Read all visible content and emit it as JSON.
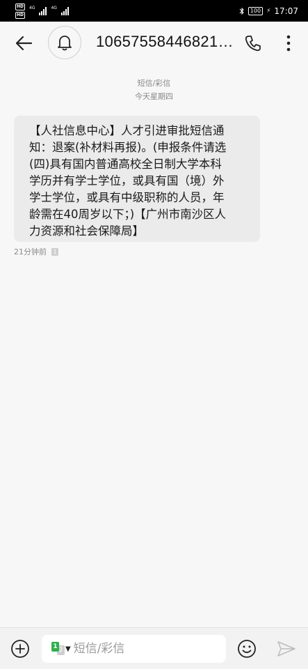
{
  "status_bar": {
    "network_1": "4G",
    "network_2": "4G",
    "battery": "100",
    "time": "17:07"
  },
  "header": {
    "contact": "10657558446821…",
    "back_icon": "arrow-left-icon",
    "notify_icon": "bell-icon",
    "call_icon": "phone-icon",
    "more_icon": "more-vertical-icon"
  },
  "conversation": {
    "type_label": "短信/彩信",
    "date_label": "今天星期四",
    "messages": [
      {
        "lines": [
          "【人社信息中心】人才引进审批短信通",
          "知：退案(补材料再报)。(申报条件请选",
          "(四)具有国内普通高校全日制大学本科",
          "学历并有学士学位，或具有国（境）外",
          "学士学位，或具有中级职称的人员，年",
          "龄需在40周岁以下；)【广州市南沙区人",
          "力资源和社会保障局】"
        ],
        "time": "21分钟前",
        "sim": "1"
      }
    ]
  },
  "composer": {
    "placeholder": "短信/彩信",
    "sim_primary": "1",
    "sim_secondary": "2"
  }
}
